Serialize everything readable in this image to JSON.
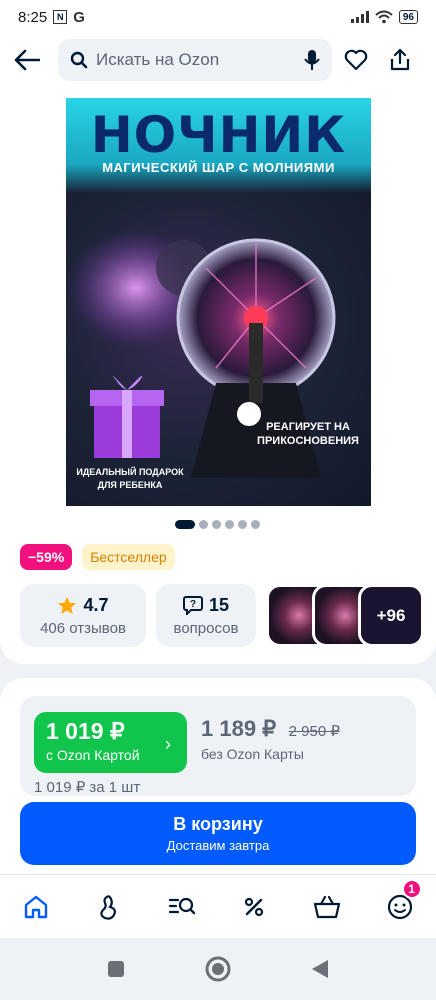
{
  "status": {
    "time": "8:25",
    "battery": "96"
  },
  "search": {
    "placeholder": "Искать на Ozon"
  },
  "product": {
    "image_title": "НОЧНИК",
    "image_subtitle": "МАГИЧЕСКИЙ ШАР С МОЛНИЯМИ",
    "image_gift_text": "ИДЕАЛЬНЫЙ ПОДАРОК ДЛЯ РЕБЕНКА",
    "image_touch_text": "РЕАГИРУЕТ НА ПРИКОСНОВЕНИЯ",
    "discount_badge": "−59%",
    "bestseller_badge": "Бестселлер",
    "rating": "4.7",
    "reviews": "406 отзывов",
    "questions_count": "15",
    "questions_label": "вопросов",
    "more_photos": "+96"
  },
  "price": {
    "ozon_card_price": "1 019 ₽",
    "ozon_card_label": "с Ozon Картой",
    "regular_price": "1 189 ₽",
    "old_price": "2 950 ₽",
    "regular_label": "без Ozon Карты",
    "per_unit": "1 019 ₽ за 1 шт"
  },
  "cart": {
    "label": "В корзину",
    "delivery": "Доставим завтра"
  },
  "tabbar": {
    "notification_count": "1"
  },
  "colors": {
    "accent": "#005bff",
    "green": "#10c44c",
    "pink": "#f1117e",
    "text": "#001a34"
  }
}
